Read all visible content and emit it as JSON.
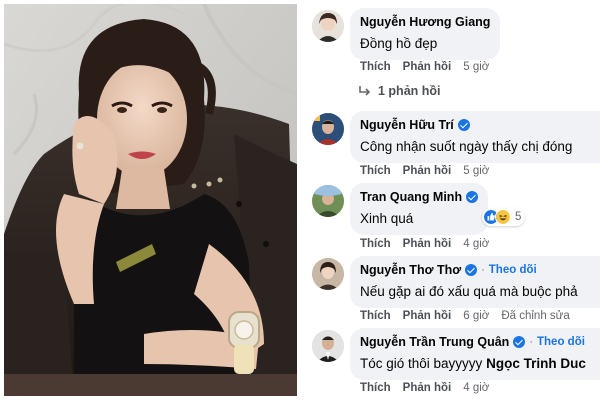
{
  "photo": {
    "alt_icon": "woman-with-wristwatch-photo"
  },
  "comments": [
    {
      "author": "Nguyễn Hương Giang",
      "verified": false,
      "text": "Đồng hồ đẹp",
      "actions": {
        "like": "Thích",
        "reply": "Phản hồi",
        "time": "5 giờ"
      },
      "replies_label": "1 phản hồi"
    },
    {
      "author": "Nguyễn Hữu Trí",
      "verified": true,
      "text": "Công nhận suốt ngày thấy chị đóng",
      "actions": {
        "like": "Thích",
        "reply": "Phản hồi",
        "time": "5 giờ"
      }
    },
    {
      "author": "Tran Quang Minh",
      "verified": true,
      "text": "Xinh quá",
      "actions": {
        "like": "Thích",
        "reply": "Phản hồi",
        "time": "4 giờ"
      },
      "reactions": {
        "icons": [
          "like-reaction-icon",
          "haha-reaction-icon"
        ],
        "count": "5"
      }
    },
    {
      "author": "Nguyễn Thơ Thơ",
      "verified": true,
      "follow": "Theo dõi",
      "text": "Nếu gặp ai đó xấu quá mà buộc phả",
      "actions": {
        "like": "Thích",
        "reply": "Phản hồi",
        "time": "6 giờ",
        "edited": "Đã chỉnh sửa"
      }
    },
    {
      "author": "Nguyễn Trần Trung Quân",
      "verified": true,
      "follow": "Theo dõi",
      "text": "Tóc gió thôi bayyyyy",
      "mention": "Ngọc Trinh Duc",
      "actions": {
        "like": "Thích",
        "reply": "Phản hồi",
        "time": "4 giờ"
      }
    }
  ],
  "separator_dot": "·",
  "colors": {
    "bubble": "#f0f2f5",
    "link": "#1b74e4",
    "action": "#4b4f56",
    "muted": "#65676b"
  }
}
